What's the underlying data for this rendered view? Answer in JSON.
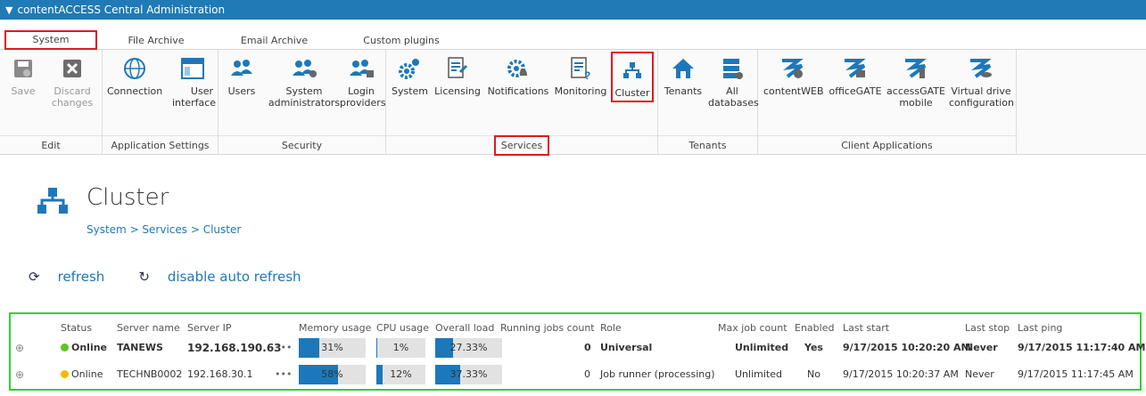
{
  "app": {
    "title": "contentACCESS Central Administration"
  },
  "tabs": [
    "System",
    "File Archive",
    "Email Archive",
    "Custom plugins"
  ],
  "ribbon": {
    "edit": {
      "label": "Edit",
      "save": "Save",
      "discard_1": "Discard",
      "discard_2": "changes"
    },
    "app_settings": {
      "label": "Application Settings",
      "connection": "Connection",
      "ui_1": "User",
      "ui_2": "interface"
    },
    "security": {
      "label": "Security",
      "users": "Users",
      "sysadmin_1": "System",
      "sysadmin_2": "administrators",
      "login_1": "Login",
      "login_2": "providers"
    },
    "services": {
      "label": "Services",
      "system": "System",
      "licensing": "Licensing",
      "notifications": "Notifications",
      "monitoring": "Monitoring",
      "cluster": "Cluster"
    },
    "tenants": {
      "label": "Tenants",
      "tenants": "Tenants",
      "alldb_1": "All",
      "alldb_2": "databases"
    },
    "client_apps": {
      "label": "Client Applications",
      "contentweb": "contentWEB",
      "officegate": "officeGATE",
      "accessgate_1": "accessGATE",
      "accessgate_2": "mobile",
      "vdrive_1": "Virtual drive",
      "vdrive_2": "configuration"
    }
  },
  "page": {
    "title": "Cluster",
    "breadcrumb": "System > Services > Cluster"
  },
  "actions": {
    "refresh": "refresh",
    "disable": "disable auto refresh"
  },
  "table": {
    "headers": {
      "status": "Status",
      "server_name": "Server name",
      "server_ip": "Server IP",
      "memory": "Memory usage",
      "cpu": "CPU usage",
      "load": "Overall load",
      "jobs": "Running jobs count",
      "role": "Role",
      "max_jobs": "Max job count",
      "enabled": "Enabled",
      "last_start": "Last start",
      "last_stop": "Last stop",
      "last_ping": "Last ping"
    },
    "rows": [
      {
        "status": "Online",
        "status_color": "#5fc41f",
        "server_name": "TANEWS",
        "server_ip": "192.168.190.63",
        "more": "•••",
        "memory_pct": 31,
        "memory_label": "31%",
        "cpu_pct": 1,
        "cpu_label": "1%",
        "load_pct": 27.33,
        "load_label": "27.33%",
        "jobs": "0",
        "role": "Universal",
        "max_jobs": "Unlimited",
        "enabled": "Yes",
        "last_start": "9/17/2015 10:20:20 AM",
        "last_stop": "Never",
        "last_ping": "9/17/2015 11:17:40 AM"
      },
      {
        "status": "Online",
        "status_color": "#f5b800",
        "server_name": "TECHNB0002",
        "server_ip": "192.168.30.1",
        "more": "•••",
        "memory_pct": 58,
        "memory_label": "58%",
        "cpu_pct": 12,
        "cpu_label": "12%",
        "load_pct": 37.33,
        "load_label": "37.33%",
        "jobs": "0",
        "role": "Job runner (processing)",
        "max_jobs": "Unlimited",
        "enabled": "No",
        "last_start": "9/17/2015 10:20:37 AM",
        "last_stop": "Never",
        "last_ping": "9/17/2015 11:17:45 AM"
      }
    ]
  },
  "colors": {
    "accent": "#1c78ba",
    "titlebar": "#1f7ab5",
    "highlight": "#e0191f",
    "grid_border": "#2fd22f"
  }
}
